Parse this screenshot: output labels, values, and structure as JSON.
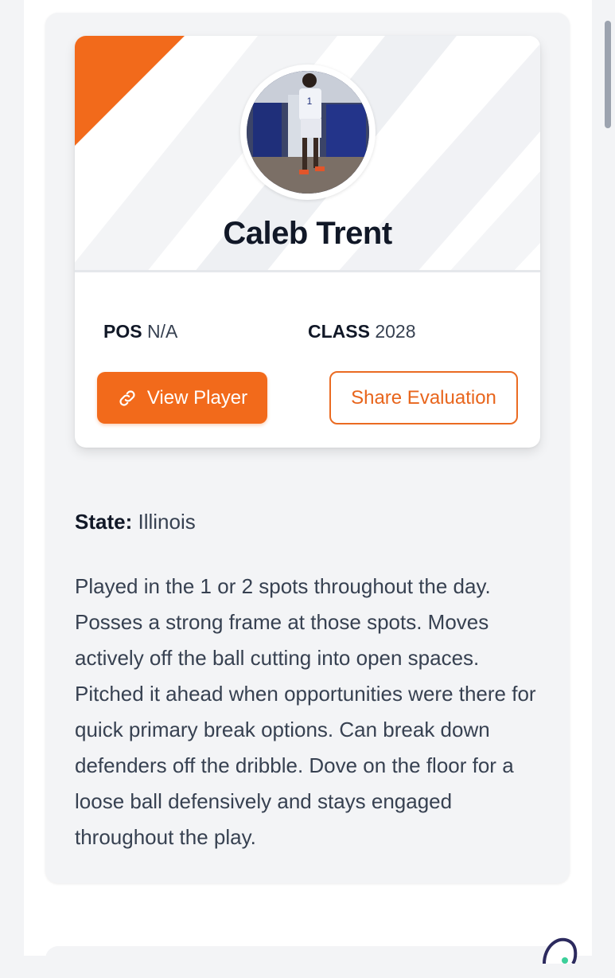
{
  "player": {
    "name": "Caleb Trent",
    "pos_label": "POS",
    "pos_value": "N/A",
    "class_label": "CLASS",
    "class_value": "2028",
    "jersey_number": "1"
  },
  "actions": {
    "view_player": "View Player",
    "share_evaluation": "Share Evaluation"
  },
  "details": {
    "state_label": "State:",
    "state_value": "Illinois",
    "evaluation": "Played in the 1 or 2 spots throughout the day. Posses a strong frame at those spots. Moves actively off the ball cutting into open spaces. Pitched it ahead when opportunities were there for quick primary break options. Can break down defenders off the dribble. Dove on the floor for a loose ball defensively and stays engaged throughout the play."
  },
  "colors": {
    "accent": "#f26a1b",
    "text_dark": "#111827",
    "text_body": "#374151",
    "card_bg": "#f3f4f6"
  },
  "icons": {
    "view_player": "link-icon"
  }
}
